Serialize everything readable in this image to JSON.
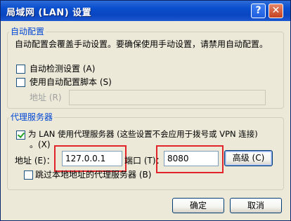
{
  "window": {
    "title": "局域网 (LAN) 设置",
    "help_glyph": "?",
    "close_glyph": "✕"
  },
  "auto_config": {
    "group_title": "自动配置",
    "description": "自动配置会覆盖手动设置。要确保使用手动设置，请禁用自动配置。",
    "auto_detect": {
      "label": "自动检测设置 (A)",
      "checked": false
    },
    "use_script": {
      "label": "使用自动配置脚本 (S)",
      "checked": false
    },
    "address_label": "地址 (R)",
    "address_value": ""
  },
  "proxy": {
    "group_title": "代理服务器",
    "use_proxy": {
      "label_line1": "为 LAN 使用代理服务器 (这些设置不会应用于拨号或 VPN 连接)",
      "label_line2": "。(X)",
      "checked": true
    },
    "address_label": "地址 (E)：",
    "address_value": "127.0.0.1",
    "port_label": "端口 (T)：",
    "port_value": "8080",
    "advanced_button": "高级 (C)",
    "bypass_local": {
      "label": "跳过本地地址的代理服务器 (B)",
      "checked": false
    }
  },
  "buttons": {
    "ok": "确定",
    "cancel": "取消"
  },
  "colors": {
    "titlebar": "#0a4fcf",
    "highlight_box": "#e0242a",
    "group_title": "#0046d5",
    "checkbox_check": "#21a121"
  },
  "icons": [
    "help-icon",
    "close-icon",
    "checkmark-icon"
  ]
}
